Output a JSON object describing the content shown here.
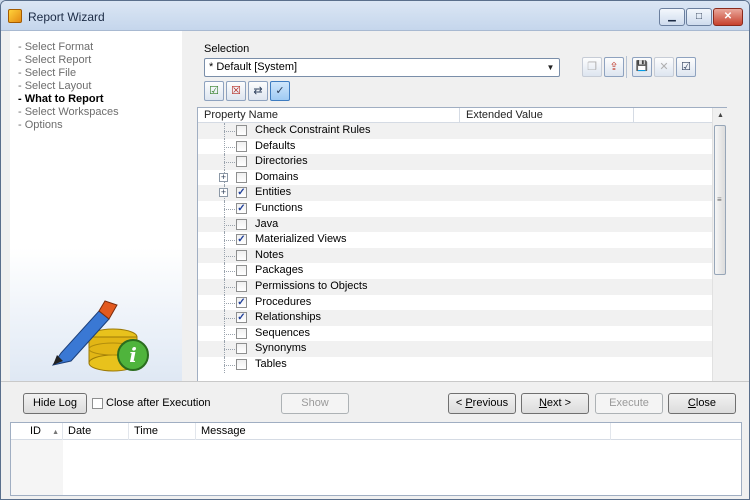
{
  "window": {
    "title": "Report Wizard",
    "min_glyph": "▁",
    "max_glyph": "□",
    "close_glyph": "✕"
  },
  "sidebar": {
    "steps": [
      {
        "label": "- Select Format",
        "active": false
      },
      {
        "label": "- Select Report",
        "active": false
      },
      {
        "label": "- Select File",
        "active": false
      },
      {
        "label": "- Select Layout",
        "active": false
      },
      {
        "label": "- What to Report",
        "active": true
      },
      {
        "label": "- Select Workspaces",
        "active": false
      },
      {
        "label": "- Options",
        "active": false
      }
    ],
    "info_glyph": "i"
  },
  "selection": {
    "label": "Selection",
    "value": "* Default [System]",
    "arrow": "▼"
  },
  "toolbar": {
    "top": [
      {
        "name": "copy-selection-icon",
        "glyph": "❐",
        "dim": true
      },
      {
        "name": "load-selection-icon",
        "glyph": "⇪",
        "dim": false
      },
      {
        "name": "save-selection-icon",
        "glyph": "💾",
        "dim": false
      },
      {
        "name": "delete-selection-icon",
        "glyph": "✕",
        "dim": true
      },
      {
        "name": "manage-selections-icon",
        "glyph": "☑",
        "dim": false
      }
    ],
    "tree": [
      {
        "name": "check-all-icon",
        "glyph": "☑",
        "active": false
      },
      {
        "name": "uncheck-all-icon",
        "glyph": "☒",
        "active": false
      },
      {
        "name": "invert-check-icon",
        "glyph": "⇄",
        "active": false
      },
      {
        "name": "check-visible-icon",
        "glyph": "✓",
        "active": true
      }
    ]
  },
  "grid": {
    "columns": [
      "Property Name",
      "Extended Value"
    ],
    "rows": [
      {
        "label": "Check Constraint Rules",
        "checked": false,
        "expandable": false
      },
      {
        "label": "Defaults",
        "checked": false,
        "expandable": false
      },
      {
        "label": "Directories",
        "checked": false,
        "expandable": false
      },
      {
        "label": "Domains",
        "checked": false,
        "expandable": true
      },
      {
        "label": "Entities",
        "checked": true,
        "expandable": true
      },
      {
        "label": "Functions",
        "checked": true,
        "expandable": false
      },
      {
        "label": "Java",
        "checked": false,
        "expandable": false
      },
      {
        "label": "Materialized Views",
        "checked": true,
        "expandable": false
      },
      {
        "label": "Notes",
        "checked": false,
        "expandable": false
      },
      {
        "label": "Packages",
        "checked": false,
        "expandable": false
      },
      {
        "label": "Permissions to Objects",
        "checked": false,
        "expandable": false
      },
      {
        "label": "Procedures",
        "checked": true,
        "expandable": false
      },
      {
        "label": "Relationships",
        "checked": true,
        "expandable": false
      },
      {
        "label": "Sequences",
        "checked": false,
        "expandable": false
      },
      {
        "label": "Synonyms",
        "checked": false,
        "expandable": false
      },
      {
        "label": "Tables",
        "checked": false,
        "expandable": false
      }
    ],
    "check_glyph": "✓",
    "expand_glyph": "+",
    "scroll_up": "▲",
    "scroll_down": "▼",
    "grip": "≡"
  },
  "footer": {
    "hide_log": "Hide Log",
    "close_after_execution": "Close after Execution",
    "show": "Show",
    "previous_prefix": "< ",
    "previous_u": "P",
    "previous_rest": "revious",
    "next_u": "N",
    "next_rest": "ext >",
    "execute": "Execute",
    "close_u": "C",
    "close_rest": "lose"
  },
  "log": {
    "columns": [
      "ID",
      "Date",
      "Time",
      "Message"
    ],
    "sort_glyph": "▲"
  }
}
